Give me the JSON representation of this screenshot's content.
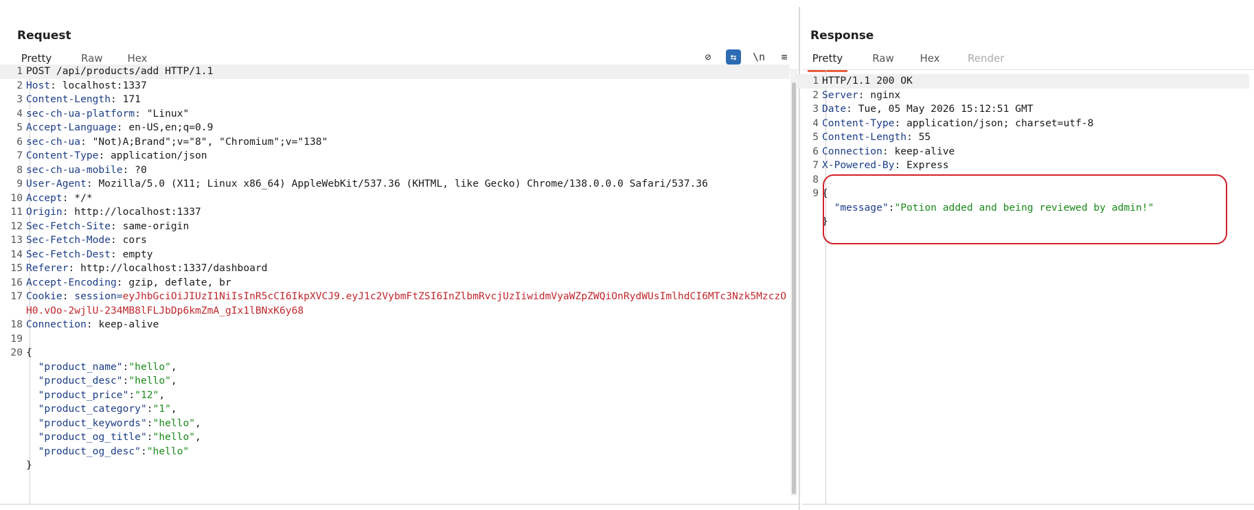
{
  "request": {
    "title": "Request",
    "tabs": [
      {
        "label": "Pretty",
        "active": true
      },
      {
        "label": "Raw",
        "active": false
      },
      {
        "label": "Hex",
        "active": false
      }
    ],
    "toolbar": [
      {
        "icon": "hide-icon",
        "glyph": "⊘"
      },
      {
        "icon": "wrap-lines-icon",
        "glyph": "⇆"
      },
      {
        "icon": "newline-icon",
        "glyph": "\\n"
      },
      {
        "icon": "menu-icon",
        "glyph": "≡"
      }
    ],
    "lines": {
      "l1": {
        "num": "1",
        "text": "POST /api/products/add HTTP/1.1"
      },
      "l2": {
        "num": "2",
        "key": "Host",
        "val": ": localhost:1337"
      },
      "l3": {
        "num": "3",
        "key": "Content-Length",
        "val": ": 171"
      },
      "l4": {
        "num": "4",
        "key": "sec-ch-ua-platform",
        "val": ": \"Linux\""
      },
      "l5": {
        "num": "5",
        "key": "Accept-Language",
        "val": ": en-US,en;q=0.9"
      },
      "l6": {
        "num": "6",
        "key": "sec-ch-ua",
        "val": ": \"Not)A;Brand\";v=\"8\", \"Chromium\";v=\"138\""
      },
      "l7": {
        "num": "7",
        "key": "Content-Type",
        "val": ": application/json"
      },
      "l8": {
        "num": "8",
        "key": "sec-ch-ua-mobile",
        "val": ": ?0"
      },
      "l9": {
        "num": "9",
        "key": "User-Agent",
        "val": ": Mozilla/5.0 (X11; Linux x86_64) AppleWebKit/537.36 (KHTML, like Gecko) Chrome/138.0.0.0 Safari/537.36"
      },
      "l10": {
        "num": "10",
        "key": "Accept",
        "val": ": */*"
      },
      "l11": {
        "num": "11",
        "key": "Origin",
        "val": ": http://localhost:1337"
      },
      "l12": {
        "num": "12",
        "key": "Sec-Fetch-Site",
        "val": ": same-origin"
      },
      "l13": {
        "num": "13",
        "key": "Sec-Fetch-Mode",
        "val": ": cors"
      },
      "l14": {
        "num": "14",
        "key": "Sec-Fetch-Dest",
        "val": ": empty"
      },
      "l15": {
        "num": "15",
        "key": "Referer",
        "val": ": http://localhost:1337/dashboard"
      },
      "l16": {
        "num": "16",
        "key": "Accept-Encoding",
        "val": ": gzip, deflate, br"
      },
      "l17": {
        "num": "17",
        "key": "Cookie",
        "sep": ": ",
        "cookie_name": "session=",
        "cookie_val": "eyJhbGciOiJIUzI1NiIsInR5cCI6IkpXVCJ9.eyJ1c2VybmFtZSI6InZlbmRvcjUzIiwidmVyaWZpZWQiOnRydWUsImlhdCI6MTc3Nzk5MzczOH0.vOo-2wjlU-234MB8lFLJbDp6kmZmA_gIx1lBNxK6y68"
      },
      "l18": {
        "num": "18",
        "key": "Connection",
        "val": ": keep-alive"
      },
      "l19": {
        "num": "19"
      },
      "l20": {
        "num": "20",
        "text": "{"
      }
    },
    "body": {
      "product_name": {
        "k": "\"product_name\"",
        "v": "\"hello\"",
        "end": ","
      },
      "product_desc": {
        "k": "\"product_desc\"",
        "v": "\"hello\"",
        "end": ","
      },
      "product_price": {
        "k": "\"product_price\"",
        "v": "\"12\"",
        "end": ","
      },
      "product_category": {
        "k": "\"product_category\"",
        "v": "\"1\"",
        "end": ","
      },
      "product_keywords": {
        "k": "\"product_keywords\"",
        "v": "\"hello\"",
        "end": ","
      },
      "product_og_title": {
        "k": "\"product_og_title\"",
        "v": "\"hello\"",
        "end": ","
      },
      "product_og_desc": {
        "k": "\"product_og_desc\"",
        "v": "\"hello\"",
        "end": ""
      },
      "close": "}"
    }
  },
  "response": {
    "title": "Response",
    "tabs": [
      {
        "label": "Pretty",
        "active": true
      },
      {
        "label": "Raw",
        "active": false
      },
      {
        "label": "Hex",
        "active": false
      },
      {
        "label": "Render",
        "active": false
      }
    ],
    "lines": {
      "l1": {
        "num": "1",
        "text": "HTTP/1.1 200 OK"
      },
      "l2": {
        "num": "2",
        "key": "Server",
        "val": ": nginx"
      },
      "l3": {
        "num": "3",
        "key": "Date",
        "val": ": Tue, 05 May 2026 15:12:51 GMT"
      },
      "l4": {
        "num": "4",
        "key": "Content-Type",
        "val": ": application/json; charset=utf-8"
      },
      "l5": {
        "num": "5",
        "key": "Content-Length",
        "val": ": 55"
      },
      "l6": {
        "num": "6",
        "key": "Connection",
        "val": ": keep-alive"
      },
      "l7": {
        "num": "7",
        "key": "X-Powered-By",
        "val": ": Express"
      },
      "l8": {
        "num": "8"
      },
      "l9": {
        "num": "9",
        "text": "{"
      }
    },
    "body": {
      "message_key": "\"message\"",
      "message_val": "\"Potion added and being reviewed by admin!\"",
      "close": "}"
    }
  },
  "colors": {
    "accent_tab": "#e8603c",
    "header_key": "#1c3d87",
    "cookie": "#c0272d",
    "json_string": "#1a8a1a",
    "highlight_box": "#d0202a"
  }
}
